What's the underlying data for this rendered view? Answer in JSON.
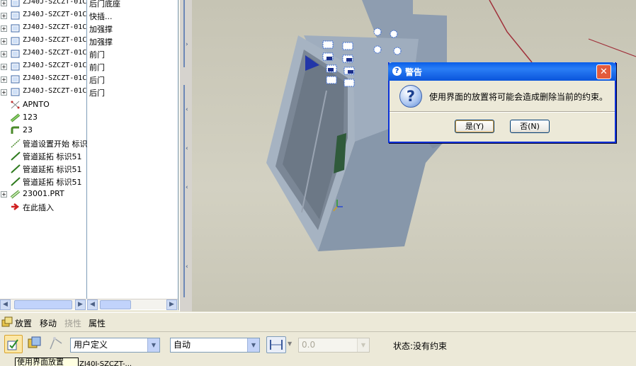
{
  "tree": {
    "rows": [
      {
        "name": "ZJ40J-SZCZT-01C",
        "note": "后门底座",
        "icon": "part-icon",
        "expand": "+"
      },
      {
        "name": "ZJ40J-SZCZT-01C",
        "note": "快插...",
        "icon": "part-icon",
        "expand": "+"
      },
      {
        "name": "ZJ40J-SZCZT-01C",
        "note": "加强撑",
        "icon": "part-icon",
        "expand": "+"
      },
      {
        "name": "ZJ40J-SZCZT-01C",
        "note": "加强撑",
        "icon": "part-icon",
        "expand": "+"
      },
      {
        "name": "ZJ40J-SZCZT-01C",
        "note": "前门",
        "icon": "part-icon",
        "expand": "+"
      },
      {
        "name": "ZJ40J-SZCZT-01C",
        "note": "前门",
        "icon": "part-icon",
        "expand": "+"
      },
      {
        "name": "ZJ40J-SZCZT-01C",
        "note": "后门",
        "icon": "part-icon",
        "expand": "+"
      },
      {
        "name": "ZJ40J-SZCZT-01C",
        "note": "后门",
        "icon": "part-icon",
        "expand": "+"
      },
      {
        "full": "APNTO",
        "icon": "datum-points-icon"
      },
      {
        "full": "123",
        "icon": "pipe-icon"
      },
      {
        "full": "23",
        "icon": "pipe-bend-icon"
      },
      {
        "full": "管道设置开始 标识",
        "icon": "pipe-start-icon"
      },
      {
        "full": "管道延拓 标识51",
        "icon": "pipe-extend-icon"
      },
      {
        "full": "管道延拓 标识51",
        "icon": "pipe-extend-icon"
      },
      {
        "full": "管道延拓 标识51",
        "icon": "pipe-extend-icon"
      },
      {
        "full": "23001.PRT",
        "icon": "pipe-part-icon",
        "expand": "+"
      },
      {
        "full": "在此插入",
        "icon": "insert-arrow-icon"
      }
    ]
  },
  "dialog": {
    "title": "警告",
    "message": "使用界面的放置将可能会造成删除当前的约束。",
    "yes_label": "是(Y)",
    "no_label": "否(N)",
    "close_glyph": "✕"
  },
  "tabs": {
    "placement": "放置",
    "move": "移动",
    "flexibility": "挠性",
    "properties": "属性"
  },
  "dashboard": {
    "constraint_set": "用户定义",
    "constraint_type": "自动",
    "offset_value": "0.0",
    "status": "状态:没有约束"
  },
  "tooltip": "使用界面放置",
  "statusline": "ZJ40J-SZCZT-..."
}
